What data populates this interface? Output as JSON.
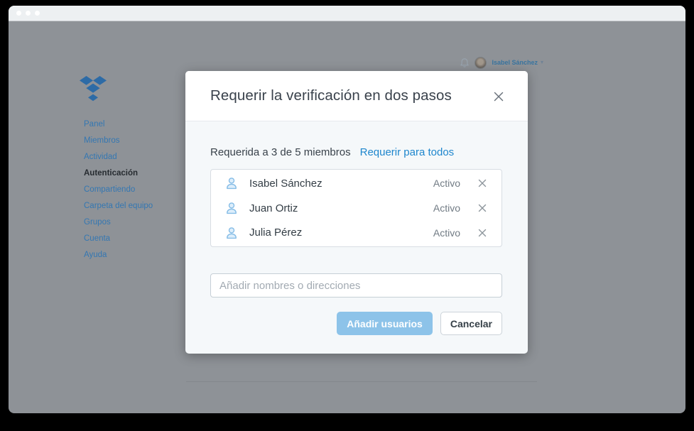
{
  "window": {
    "titlebar": {
      "controls": [
        "close",
        "minimize",
        "maximize"
      ]
    }
  },
  "header": {
    "user_name": "Isabel Sánchez",
    "chevron": "▾"
  },
  "sidebar": {
    "items": [
      {
        "label": "Panel"
      },
      {
        "label": "Miembros"
      },
      {
        "label": "Actividad"
      },
      {
        "label": "Autenticación",
        "active": true
      },
      {
        "label": "Compartiendo"
      },
      {
        "label": "Carpeta del equipo"
      },
      {
        "label": "Grupos"
      },
      {
        "label": "Cuenta"
      },
      {
        "label": "Ayuda"
      }
    ]
  },
  "modal": {
    "title": "Requerir la verificación en dos pasos",
    "summary": "Requerida a 3 de 5 miembros",
    "require_all_link": "Requerir para todos",
    "members": [
      {
        "name": "Isabel Sánchez",
        "status": "Activo"
      },
      {
        "name": "Juan Ortiz",
        "status": "Activo"
      },
      {
        "name": "Julia Pérez",
        "status": "Activo"
      }
    ],
    "input_placeholder": "Añadir nombres o direcciones",
    "add_button": "Añadir usuarios",
    "cancel_button": "Cancelar"
  },
  "colors": {
    "brand_blue_dimmed": "#2d6ba6",
    "sidebar_link": "#3477b2",
    "link_blue": "#1e86cd",
    "primary_button": "#8dc3e9",
    "modal_body_bg": "#f5f8fa",
    "dim_background": "#8e9297",
    "member_icon_blue": "#85bce6"
  }
}
